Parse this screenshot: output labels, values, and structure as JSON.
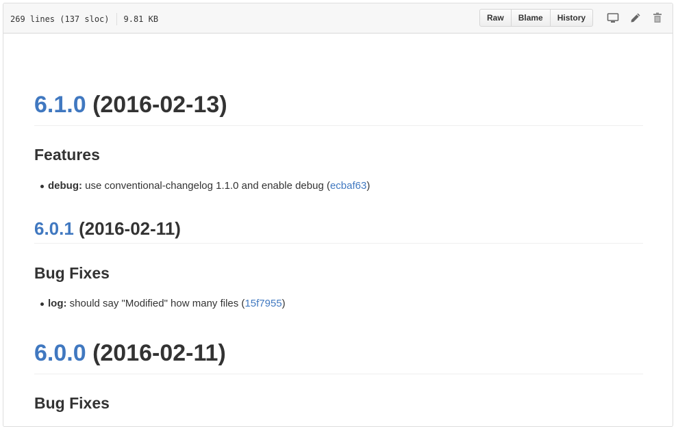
{
  "file_header": {
    "lines": "269 lines (137 sloc)",
    "size": "9.81 KB",
    "buttons": {
      "raw": "Raw",
      "blame": "Blame",
      "history": "History"
    },
    "icons": [
      "desktop-icon",
      "pencil-icon",
      "trash-icon"
    ]
  },
  "colors": {
    "link": "#4078c0",
    "text": "#333333",
    "rule": "#eeeeee",
    "header_bg": "#f7f7f7"
  },
  "releases": [
    {
      "version": "6.1.0",
      "date": "(2016-02-13)",
      "section": "Features",
      "items": [
        {
          "scope": "debug:",
          "text": " use conventional-changelog 1.1.0 and enable debug (",
          "commit": "ecbaf63",
          "close": ")"
        }
      ]
    },
    {
      "version": "6.0.1",
      "date": "(2016-02-11)",
      "section": "Bug Fixes",
      "items": [
        {
          "scope": "log:",
          "text": " should say \"Modified\" how many files (",
          "commit": "15f7955",
          "close": ")"
        }
      ]
    },
    {
      "version": "6.0.0",
      "date": "(2016-02-11)",
      "section": "Bug Fixes",
      "items": []
    }
  ]
}
